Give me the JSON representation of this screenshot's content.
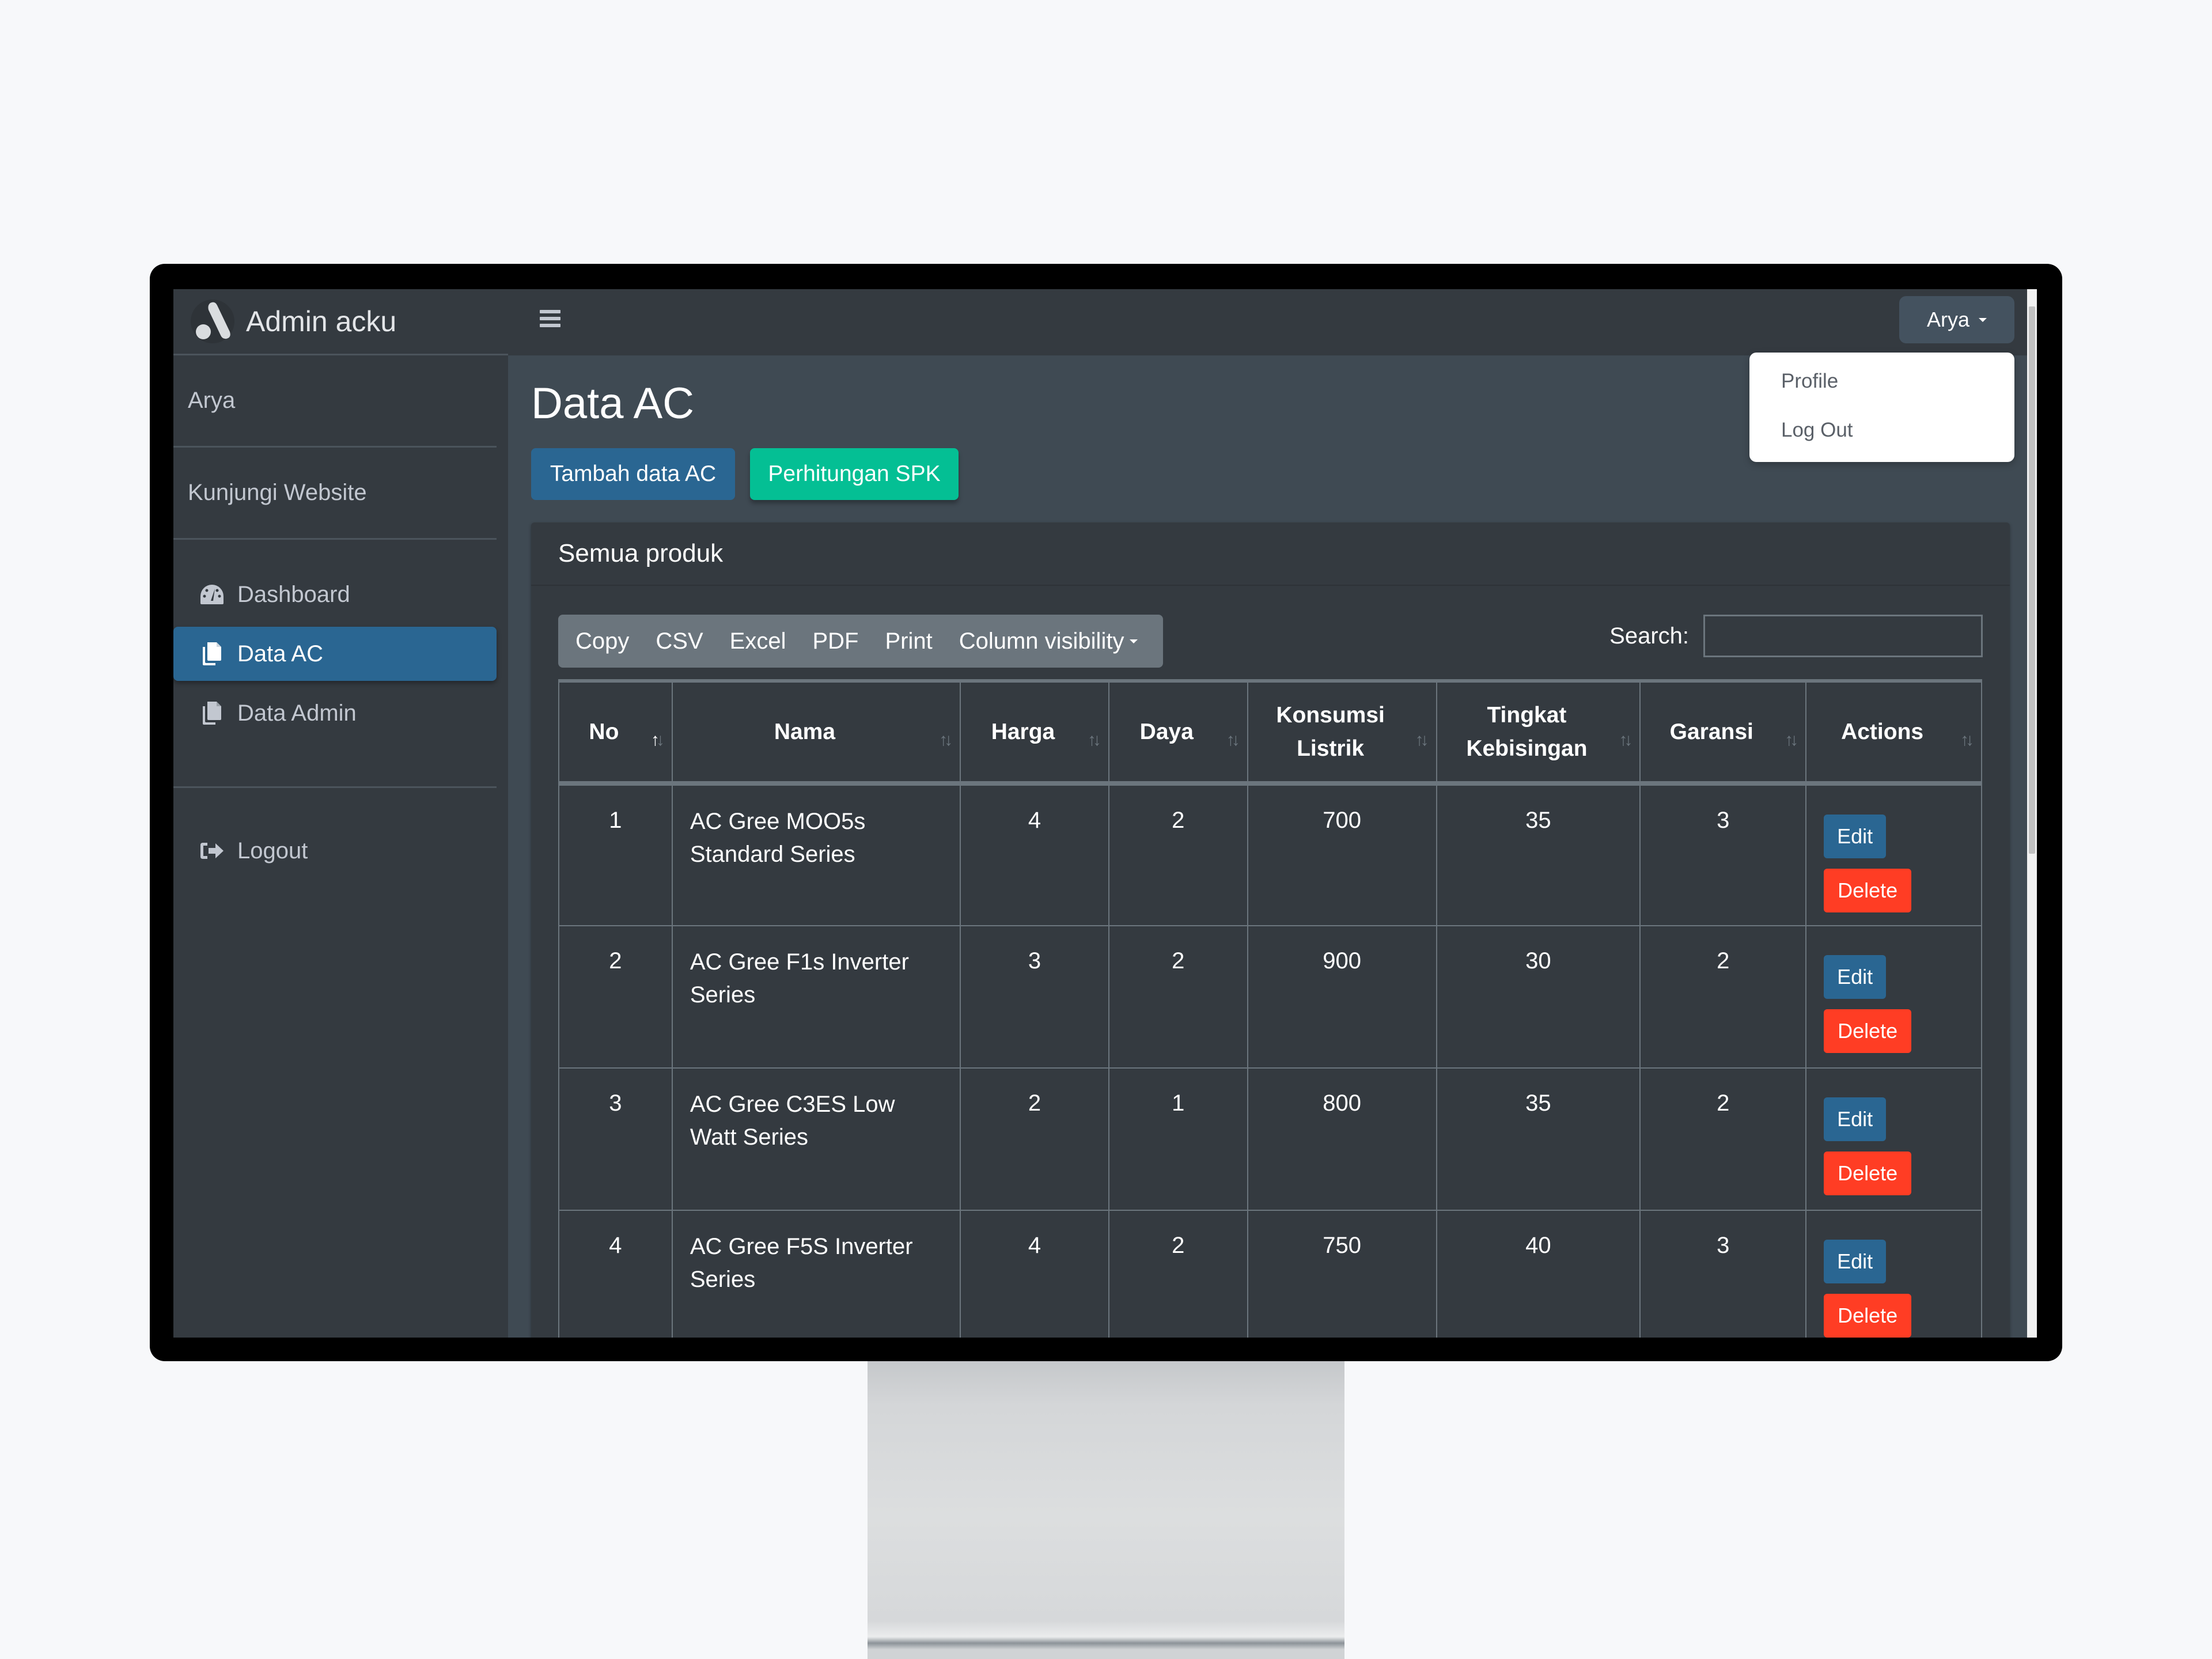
{
  "brand": {
    "name": "Admin acku"
  },
  "sidebar": {
    "user_name": "Arya",
    "visit_website": "Kunjungi Website",
    "items": [
      {
        "label": "Dashboard",
        "icon": "tachometer-icon",
        "active": false
      },
      {
        "label": "Data AC",
        "icon": "copy-icon",
        "active": true
      },
      {
        "label": "Data Admin",
        "icon": "copy-icon",
        "active": false
      }
    ],
    "logout_label": "Logout"
  },
  "topbar": {
    "user_button": "Arya",
    "dropdown": [
      "Profile",
      "Log Out"
    ]
  },
  "page": {
    "title": "Data AC",
    "add_button": "Tambah data AC",
    "spk_button": "Perhitungan SPK",
    "card_title": "Semua produk"
  },
  "toolbar": {
    "buttons": [
      "Copy",
      "CSV",
      "Excel",
      "PDF",
      "Print"
    ],
    "column_visibility": "Column visibility",
    "search_label": "Search:",
    "search_value": ""
  },
  "table": {
    "columns": [
      {
        "line1": "No",
        "line2": "",
        "sorted": "asc"
      },
      {
        "line1": "Nama",
        "line2": "",
        "sorted": ""
      },
      {
        "line1": "Harga",
        "line2": "",
        "sorted": ""
      },
      {
        "line1": "Daya",
        "line2": "",
        "sorted": ""
      },
      {
        "line1": "Konsumsi",
        "line2": "Listrik",
        "sorted": ""
      },
      {
        "line1": "Tingkat",
        "line2": "Kebisingan",
        "sorted": ""
      },
      {
        "line1": "Garansi",
        "line2": "",
        "sorted": ""
      },
      {
        "line1": "Actions",
        "line2": "",
        "sorted": ""
      }
    ],
    "rows": [
      {
        "no": "1",
        "nama": "AC Gree MOO5s Standard Series",
        "harga": "4",
        "daya": "2",
        "konsumsi": "700",
        "kebisingan": "35",
        "garansi": "3"
      },
      {
        "no": "2",
        "nama": "AC Gree F1s Inverter Series",
        "harga": "3",
        "daya": "2",
        "konsumsi": "900",
        "kebisingan": "30",
        "garansi": "2"
      },
      {
        "no": "3",
        "nama": "AC Gree C3ES Low Watt Series",
        "harga": "2",
        "daya": "1",
        "konsumsi": "800",
        "kebisingan": "35",
        "garansi": "2"
      },
      {
        "no": "4",
        "nama": "AC Gree F5S Inverter Series",
        "harga": "4",
        "daya": "2",
        "konsumsi": "750",
        "kebisingan": "40",
        "garansi": "3"
      }
    ],
    "edit_label": "Edit",
    "delete_label": "Delete"
  },
  "colors": {
    "primary": "#2a6692",
    "success": "#04bf94",
    "danger": "#ff3d24",
    "sidebar_bg": "#343a40",
    "content_bg": "#3f4a53"
  }
}
